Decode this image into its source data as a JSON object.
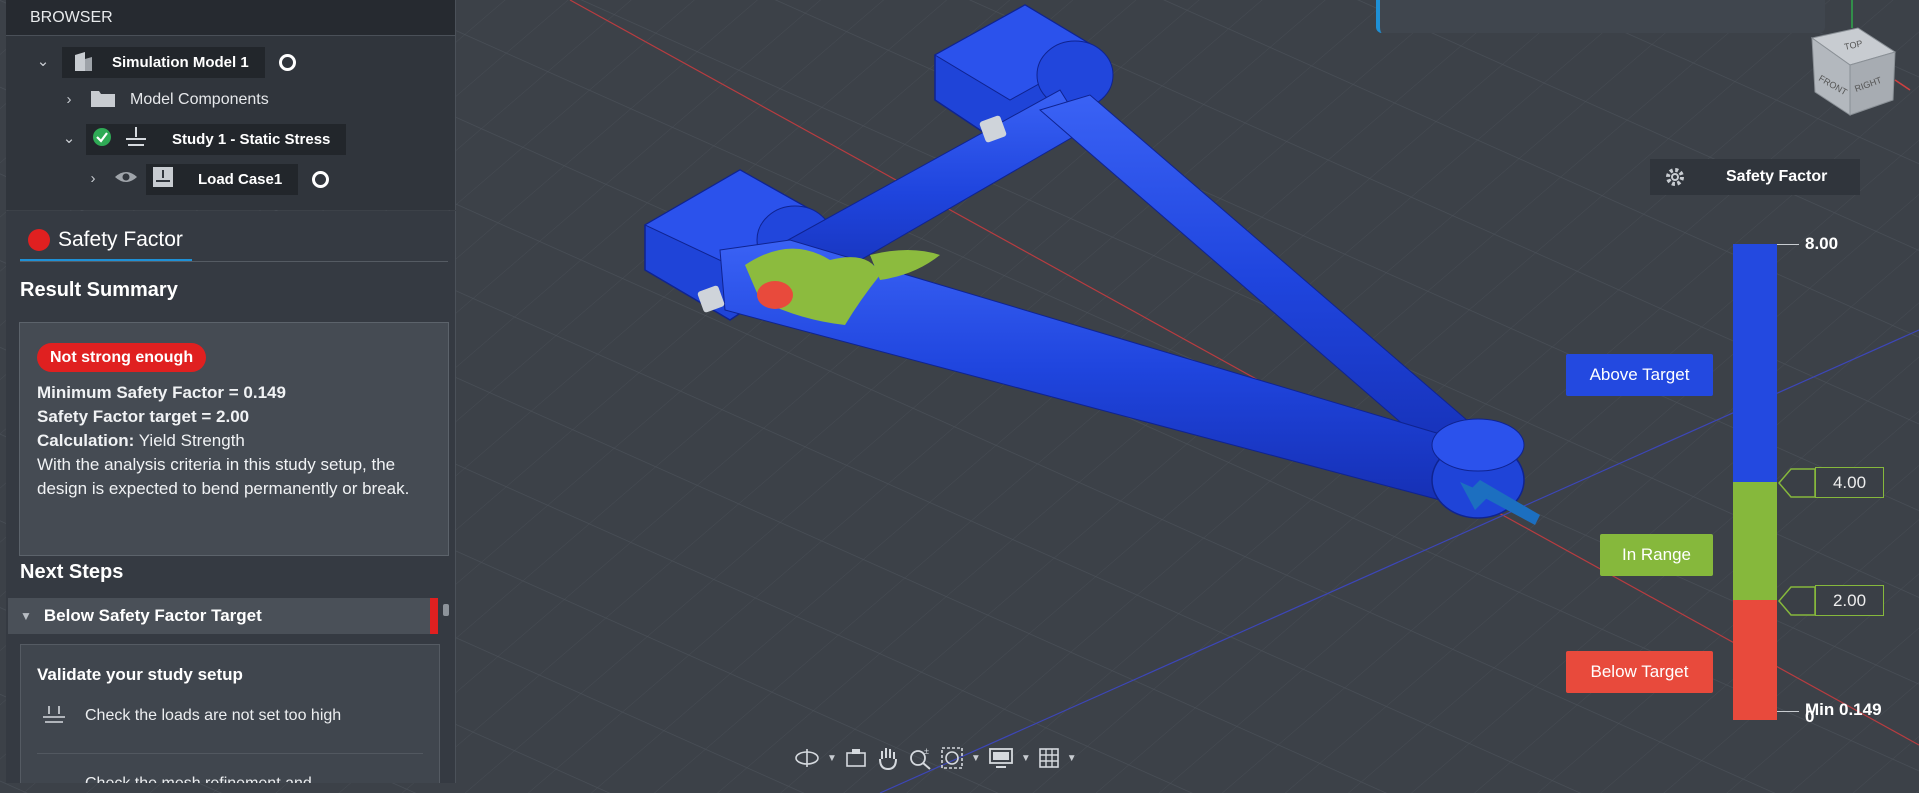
{
  "browser": {
    "header": "BROWSER",
    "tree": [
      {
        "label": "Simulation Model 1"
      },
      {
        "label": "Model Components"
      },
      {
        "label": "Study 1 - Static Stress"
      },
      {
        "label": "Load Case1"
      }
    ]
  },
  "results": {
    "tab_label": "Safety Factor",
    "result_summary_title": "Result Summary",
    "status_badge": "Not strong enough",
    "min_sf_line": "Minimum Safety Factor = 0.149",
    "target_line": "Safety Factor target = 2.00",
    "calc_label": "Calculation:",
    "calc_value": "Yield Strength",
    "description": "With the analysis criteria in this study setup, the design is expected to bend permanently or break.",
    "next_steps_title": "Next Steps",
    "below_target_label": "Below Safety Factor Target",
    "validate_title": "Validate your study setup",
    "validate_items": [
      "Check the loads are not set too high",
      "Check the mesh refinement and"
    ]
  },
  "legend": {
    "header": "Safety Factor",
    "max_value": "8.00",
    "upper_threshold": "4.00",
    "lower_threshold": "2.00",
    "zero_value": "0",
    "min_label": "Min 0.149",
    "above_target": "Above Target",
    "in_range": "In Range",
    "below_target": "Below Target",
    "colors": {
      "above": "#2349e0",
      "in_range": "#86b83c",
      "below": "#e84a3c"
    }
  },
  "viewcube": {
    "top": "TOP",
    "front": "FRONT",
    "right": "RIGHT"
  },
  "colors": {
    "accent": "#1e90d6",
    "danger": "#e02020"
  }
}
